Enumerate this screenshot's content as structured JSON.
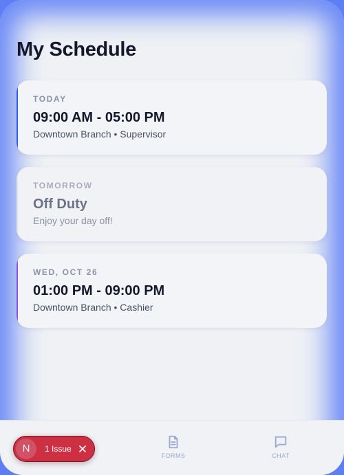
{
  "header": {
    "title": "My Schedule"
  },
  "shifts": [
    {
      "day": "TODAY",
      "time": "09:00 AM - 05:00 PM",
      "meta": "Downtown Branch • Supervisor",
      "accent": "#2f5bf0"
    },
    {
      "day": "TOMORROW",
      "time": "Off Duty",
      "meta": "Enjoy your day off!",
      "accent": "#e0e4ed"
    },
    {
      "day": "WED, OCT 26",
      "time": "01:00 PM - 09:00 PM",
      "meta": "Downtown Branch • Cashier",
      "accent": "#8a55e8"
    }
  ],
  "nav": {
    "items": [
      {
        "label": "",
        "icon": "calendar-icon"
      },
      {
        "label": "FORMS",
        "icon": "document-icon"
      },
      {
        "label": "CHAT",
        "icon": "chat-icon"
      }
    ]
  },
  "issues": {
    "avatar_letter": "N",
    "label": "1 Issue",
    "color": "#cc3042"
  },
  "colors": {
    "background": "#eff1f4",
    "frame_glow": "#5d7ef5",
    "title": "#14182b"
  }
}
